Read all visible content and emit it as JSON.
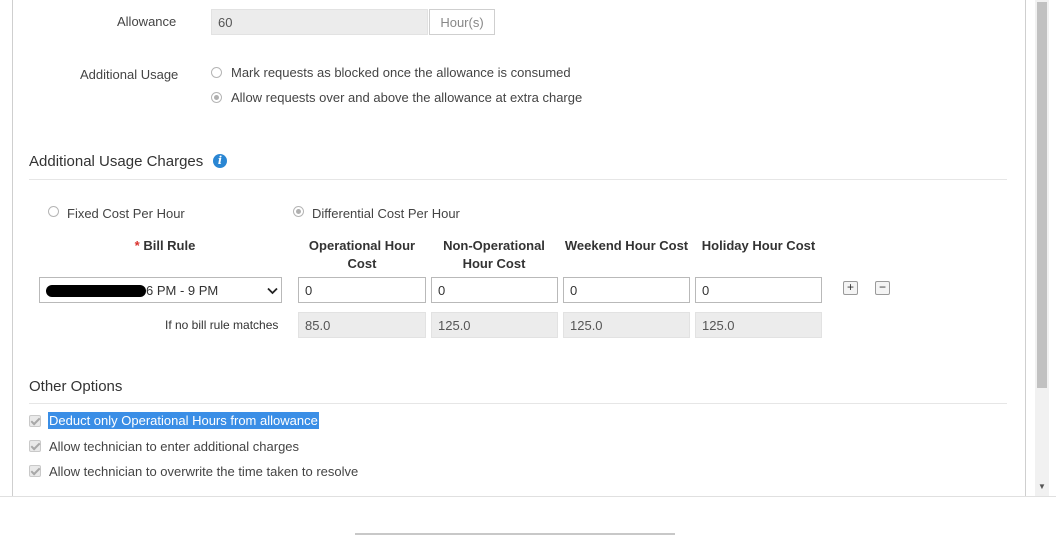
{
  "allowance": {
    "label": "Allowance",
    "value": "60",
    "unit": "Hour(s)"
  },
  "additional_usage": {
    "label": "Additional Usage",
    "options": [
      {
        "label": "Mark requests as blocked once the allowance is consumed",
        "selected": false
      },
      {
        "label": "Allow requests over and above the allowance at extra charge",
        "selected": true
      }
    ]
  },
  "charges": {
    "title": "Additional Usage Charges",
    "info_icon": "info-icon",
    "cost_types": [
      {
        "label": "Fixed Cost Per Hour",
        "selected": false
      },
      {
        "label": "Differential Cost Per Hour",
        "selected": true
      }
    ],
    "required_marker": "*",
    "columns": {
      "bill_rule": "Bill Rule",
      "operational": "Operational Hour Cost",
      "non_operational": "Non-Operational Hour Cost",
      "weekend": "Weekend Hour Cost",
      "holiday": "Holiday Hour Cost"
    },
    "row": {
      "bill_rule_value": "6 PM - 9 PM",
      "operational": "0",
      "non_operational": "0",
      "weekend": "0",
      "holiday": "0"
    },
    "add_button": "+",
    "remove_button": "−",
    "fallback": {
      "label": "If no bill rule matches",
      "operational": "85.0",
      "non_operational": "125.0",
      "weekend": "125.0",
      "holiday": "125.0"
    }
  },
  "other_options": {
    "title": "Other Options",
    "items": [
      {
        "label": "Deduct only Operational Hours from allowance",
        "checked": true,
        "highlighted": true
      },
      {
        "label": "Allow technician to enter additional charges",
        "checked": true
      },
      {
        "label": "Allow technician to overwrite the time taken to resolve",
        "checked": true
      }
    ]
  },
  "colors": {
    "accent": "#2a86d3",
    "highlight": "#3a8ee6"
  }
}
